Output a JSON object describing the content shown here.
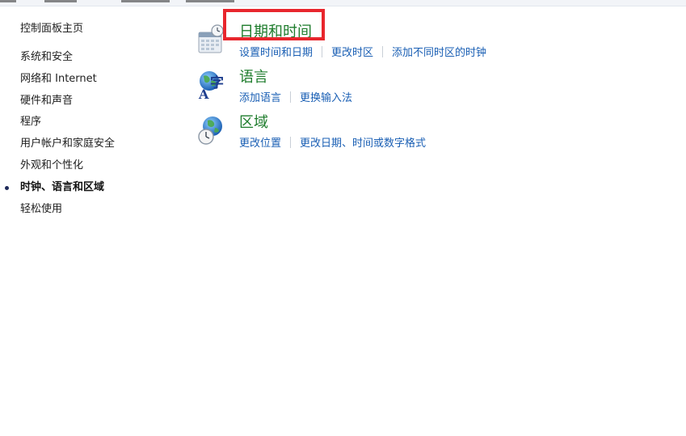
{
  "sidebar": {
    "home_label": "控制面板主页",
    "items": [
      {
        "label": "系统和安全",
        "active": false
      },
      {
        "label": "网络和 Internet",
        "active": false
      },
      {
        "label": "硬件和声音",
        "active": false
      },
      {
        "label": "程序",
        "active": false
      },
      {
        "label": "用户帐户和家庭安全",
        "active": false
      },
      {
        "label": "外观和个性化",
        "active": false
      },
      {
        "label": "时钟、语言和区域",
        "active": true
      },
      {
        "label": "轻松使用",
        "active": false
      }
    ]
  },
  "categories": [
    {
      "title": "日期和时间",
      "icon": "calendar-clock-icon",
      "links": [
        "设置时间和日期",
        "更改时区",
        "添加不同时区的时钟"
      ]
    },
    {
      "title": "语言",
      "icon": "language-globe-icon",
      "links": [
        "添加语言",
        "更换输入法"
      ]
    },
    {
      "title": "区域",
      "icon": "region-globe-clock-icon",
      "links": [
        "更改位置",
        "更改日期、时间或数字格式"
      ]
    }
  ],
  "colors": {
    "title_green": "#1e7c2c",
    "link_blue": "#1a5fb4",
    "highlight_red": "#e8262d"
  }
}
